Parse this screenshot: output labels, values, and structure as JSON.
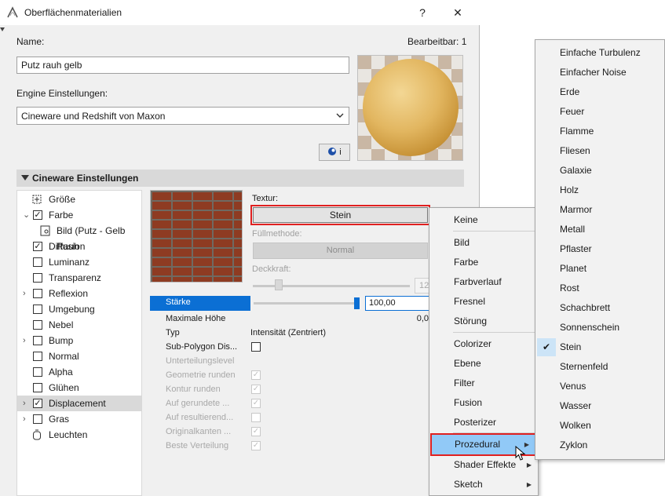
{
  "window": {
    "title": "Oberflächenmaterialien",
    "help_label": "?",
    "close_label": "✕"
  },
  "form": {
    "name_label": "Name:",
    "editable_label": "Bearbeitbar: 1",
    "name_value": "Putz rauh gelb",
    "engine_label": "Engine Einstellungen:",
    "engine_value": "Cineware und Redshift von Maxon",
    "info_button": "i"
  },
  "section": {
    "title": "Cineware Einstellungen"
  },
  "tree": [
    {
      "label": "Größe",
      "icon": "resize-icon"
    },
    {
      "label": "Farbe",
      "checked": true,
      "expanded": true
    },
    {
      "label": "Bild (Putz - Gelb Rauh",
      "icon": "image-icon"
    },
    {
      "label": "Diffusion",
      "checked": true
    },
    {
      "label": "Luminanz",
      "checked": false
    },
    {
      "label": "Transparenz",
      "checked": false
    },
    {
      "label": "Reflexion",
      "checked": false,
      "collapsed": true
    },
    {
      "label": "Umgebung",
      "checked": false
    },
    {
      "label": "Nebel",
      "checked": false
    },
    {
      "label": "Bump",
      "checked": false,
      "collapsed": true
    },
    {
      "label": "Normal",
      "checked": false
    },
    {
      "label": "Alpha",
      "checked": false
    },
    {
      "label": "Glühen",
      "checked": false
    },
    {
      "label": "Displacement",
      "checked": true,
      "collapsed": true,
      "selected": true
    },
    {
      "label": "Gras",
      "checked": false,
      "collapsed": true
    },
    {
      "label": "Leuchten",
      "icon": "lamp-icon"
    }
  ],
  "texture": {
    "label": "Textur:",
    "button": "Stein",
    "fill_label": "Füllmethode:",
    "fill_value": "Normal",
    "opacity_label": "Deckkraft:",
    "opacity_value": "12"
  },
  "properties": {
    "strength_label": "Stärke",
    "strength_value": "100,00",
    "maxheight_label": "Maximale Höhe",
    "maxheight_value": "0,0",
    "type_label": "Typ",
    "type_value": "Intensität (Zentriert)",
    "subpoly_label": "Sub-Polygon Dis...",
    "rows_disabled": [
      {
        "label": "Unterteilungslevel",
        "check": null
      },
      {
        "label": "Geometrie runden",
        "check": true
      },
      {
        "label": "Kontur runden",
        "check": true
      },
      {
        "label": "Auf gerundete ...",
        "check": true
      },
      {
        "label": "Auf resultierend...",
        "check": false
      },
      {
        "label": "Originalkanten ...",
        "check": true
      },
      {
        "label": "Beste Verteilung",
        "check": true
      }
    ]
  },
  "menu1": {
    "items": [
      "Keine",
      "Bild",
      "Farbe",
      "Farbverlauf",
      "Fresnel",
      "Störung",
      "Colorizer",
      "Ebene",
      "Filter",
      "Fusion",
      "Posterizer",
      "Prozedural",
      "Shader Effekte",
      "Sketch"
    ]
  },
  "menu2": {
    "items": [
      "Einfache Turbulenz",
      "Einfacher Noise",
      "Erde",
      "Feuer",
      "Flamme",
      "Fliesen",
      "Galaxie",
      "Holz",
      "Marmor",
      "Metall",
      "Pflaster",
      "Planet",
      "Rost",
      "Schachbrett",
      "Sonnenschein",
      "Stein",
      "Sternenfeld",
      "Venus",
      "Wasser",
      "Wolken",
      "Zyklon"
    ],
    "checked_item": "Stein"
  },
  "colors": {
    "highlight": "#91c9f7",
    "selection_blue": "#0b6fd4",
    "red_frame": "#e02020"
  }
}
